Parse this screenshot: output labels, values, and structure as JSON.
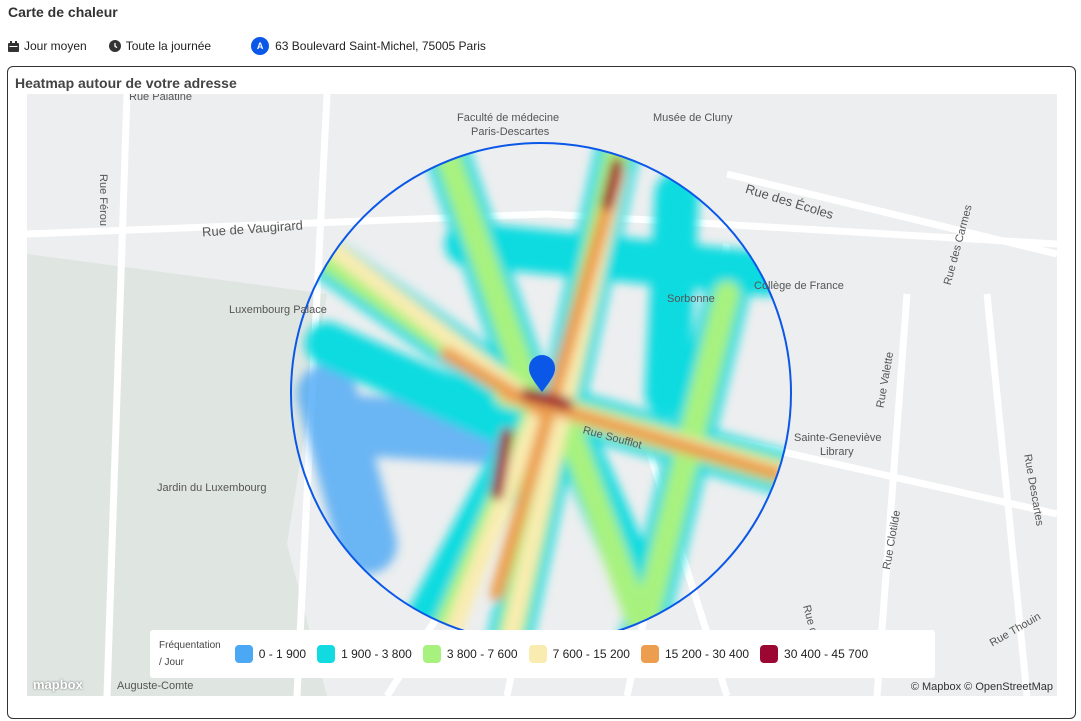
{
  "header": {
    "title": "Carte de chaleur"
  },
  "filters": [
    {
      "icon": "calendar-icon",
      "label": "Jour moyen"
    },
    {
      "icon": "clock-icon",
      "label": "Toute la journée"
    },
    {
      "badge": "A",
      "label": "63 Boulevard Saint-Michel, 75005 Paris"
    }
  ],
  "card": {
    "title": "Heatmap autour de votre adresse"
  },
  "map": {
    "labels": [
      "Rue Palatine",
      "Faculté de médecine",
      "Paris-Descartes",
      "Musée de Cluny",
      "Rue des Écoles",
      "Rue Férou",
      "Rue de Vaugirard",
      "Luxembourg Palace",
      "Sorbonne",
      "Collège de France",
      "Rue des Carmes",
      "Rue Valette",
      "Sainte-Geneviève",
      "Library",
      "Jardin du Luxembourg",
      "Rue Soufflot",
      "Rue Clotilde",
      "Rue Descartes",
      "Rue d'Ulm",
      "Rue Thouin",
      "Auguste-Comte"
    ],
    "accent": "#0b57e8",
    "attribution": "© Mapbox © OpenStreetMap",
    "logo": "mapbox"
  },
  "legend": {
    "title_line1": "Fréquentation",
    "title_line2": "/ Jour",
    "items": [
      {
        "label": "0 - 1 900",
        "color": "#4aa8f5"
      },
      {
        "label": "1 900 - 3 800",
        "color": "#11dbe0"
      },
      {
        "label": "3 800 - 7 600",
        "color": "#a7f27f"
      },
      {
        "label": "7 600 - 15 200",
        "color": "#f9ecb0"
      },
      {
        "label": "15 200 - 30 400",
        "color": "#ec9e4e"
      },
      {
        "label": "30 400 - 45 700",
        "color": "#9b0732"
      }
    ]
  }
}
